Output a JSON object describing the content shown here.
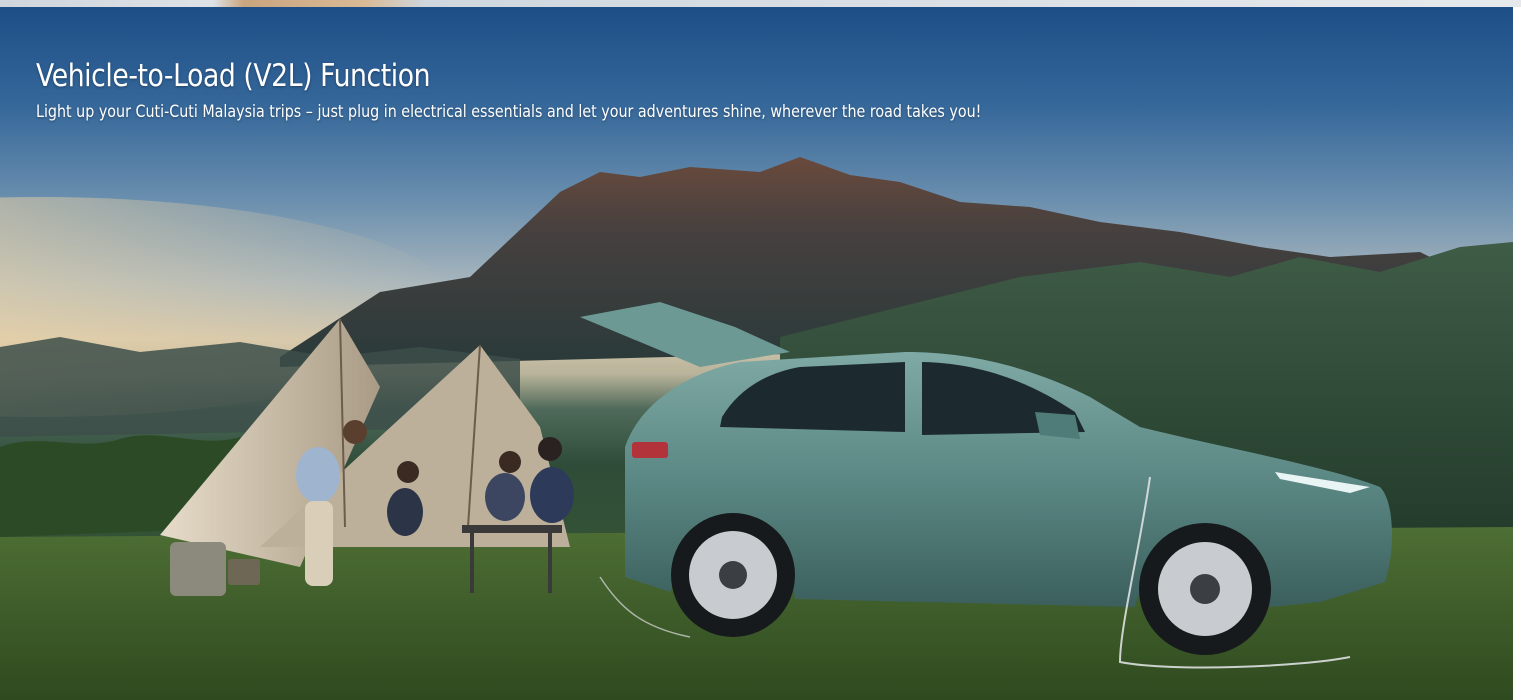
{
  "hero": {
    "title": "Vehicle-to-Load (V2L) Function",
    "subtitle": "Light up your Cuti-Cuti Malaysia trips – just plug in electrical essentials and let your adventures shine, wherever the road takes you!",
    "image": {
      "alt_scene": "family-camping-with-electric-suv-at-mountain-sunset",
      "colors": {
        "sky_top": "#1d4e86",
        "sky_horizon": "#d2c6ad",
        "mountain": "#3a3b3d",
        "grass": "#3c5f2e",
        "car_body": "#5f8f8c",
        "tent": "#c8b79e"
      }
    }
  }
}
